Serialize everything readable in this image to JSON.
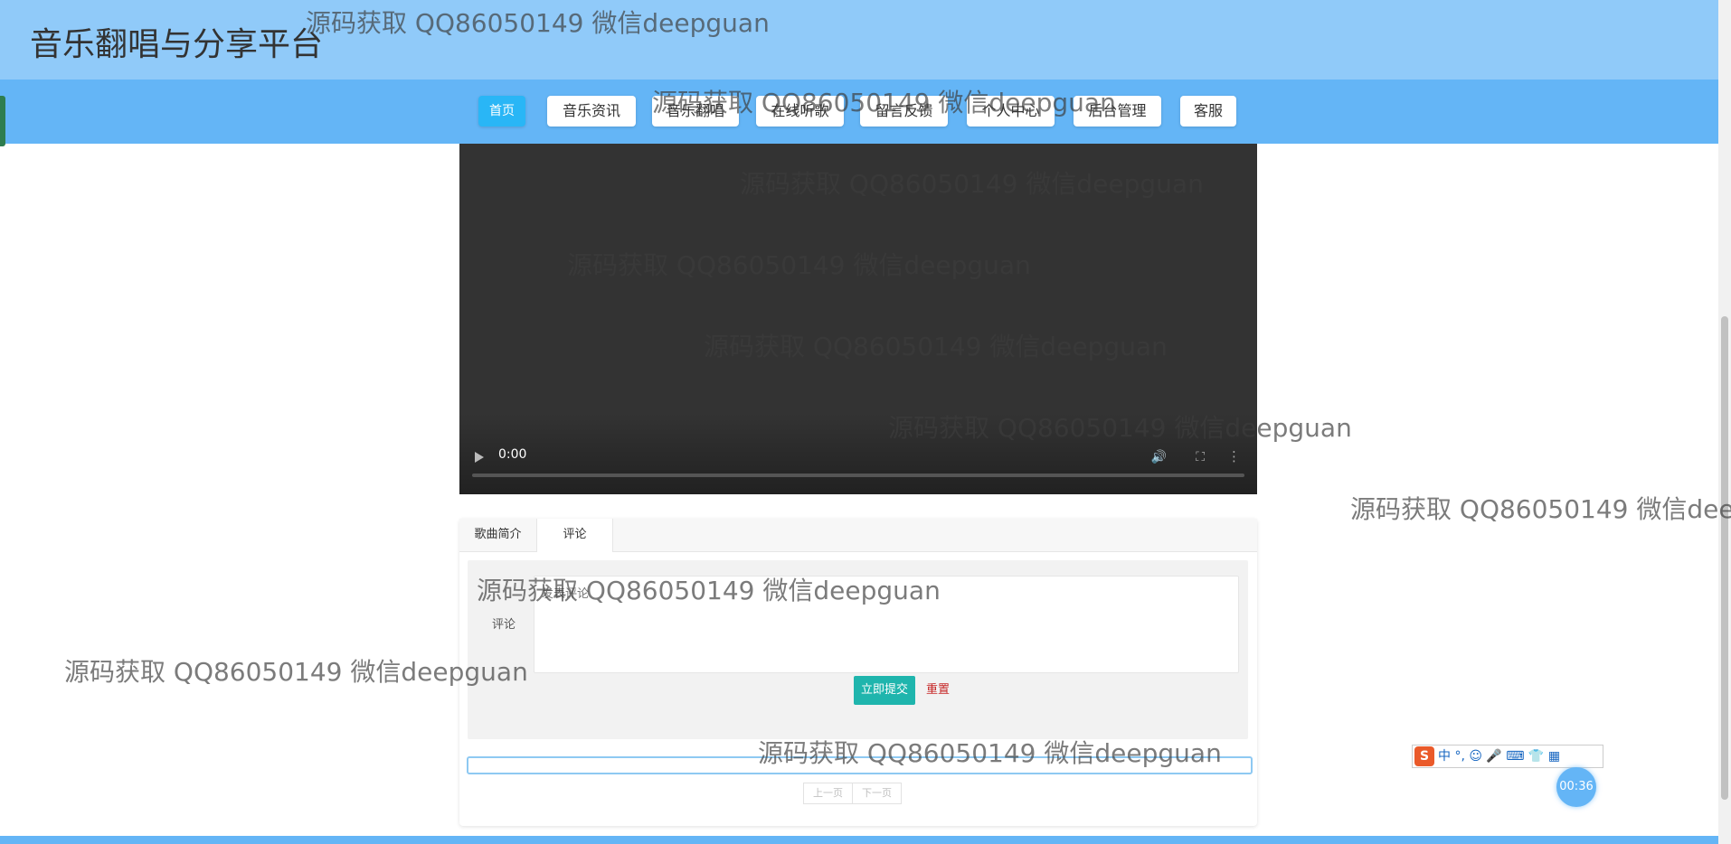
{
  "header": {
    "title": "音乐翻唱与分享平台"
  },
  "nav": {
    "items": [
      {
        "label": "首页",
        "active": true
      },
      {
        "label": "音乐资讯"
      },
      {
        "label": "音乐翻唱"
      },
      {
        "label": "在线听歌"
      },
      {
        "label": "留言反馈"
      },
      {
        "label": "个人中心"
      },
      {
        "label": "后台管理"
      },
      {
        "label": "客服"
      }
    ]
  },
  "video": {
    "time": "0:00",
    "play_icon": "play-icon",
    "volume_icon": "volume-icon",
    "fullscreen_icon": "fullscreen-icon",
    "more_icon": "more-options-icon",
    "progress": 0
  },
  "tabs": [
    {
      "label": "歌曲简介"
    },
    {
      "label": "评论",
      "active": true
    }
  ],
  "comment_form": {
    "label": "评论",
    "placeholder": "发表评论",
    "submit_label": "立即提交",
    "reset_label": "重置"
  },
  "pager": {
    "prev_label": "上一页",
    "next_label": "下一页"
  },
  "ime": {
    "logo": "S",
    "icons": "中 °, ☺ 🎤 ⌨ 👕 ▦"
  },
  "timer": {
    "text": "00:36"
  },
  "watermark": {
    "text": "源码获取 QQ86050149 微信deepguan"
  },
  "colors": {
    "header_bg": "#90caf9",
    "nav_bg": "#64b5f6",
    "active_nav": "#29b6f6",
    "submit_btn": "#1fb5ad",
    "reset_text": "#c62828"
  }
}
